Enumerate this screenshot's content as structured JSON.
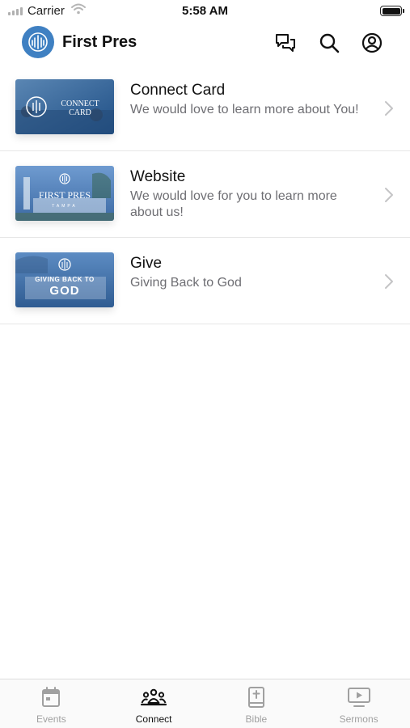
{
  "status_bar": {
    "carrier": "Carrier",
    "time": "5:58 AM"
  },
  "header": {
    "title": "First Pres",
    "icons": [
      "chat-icon",
      "search-icon",
      "account-icon"
    ]
  },
  "items": [
    {
      "title": "Connect Card",
      "description": "We would love to learn more about You!",
      "thumb_lines": [
        "CONNECT",
        "CARD"
      ]
    },
    {
      "title": "Website",
      "description": "We would love for you to learn more about us!",
      "thumb_lines": [
        "FIRST PRES",
        "TAMPA"
      ]
    },
    {
      "title": "Give",
      "description": "Giving Back to God",
      "thumb_lines": [
        "GIVING BACK TO",
        "GOD"
      ]
    }
  ],
  "tabs": [
    {
      "label": "Events",
      "icon": "calendar-icon",
      "active": false
    },
    {
      "label": "Connect",
      "icon": "people-icon",
      "active": true
    },
    {
      "label": "Bible",
      "icon": "bible-icon",
      "active": false
    },
    {
      "label": "Sermons",
      "icon": "video-icon",
      "active": false
    }
  ],
  "colors": {
    "brand_blue": "#3f80c2",
    "inactive_tab": "#a0a0a0",
    "active_tab": "#111111",
    "subtitle": "#6e6e73"
  }
}
